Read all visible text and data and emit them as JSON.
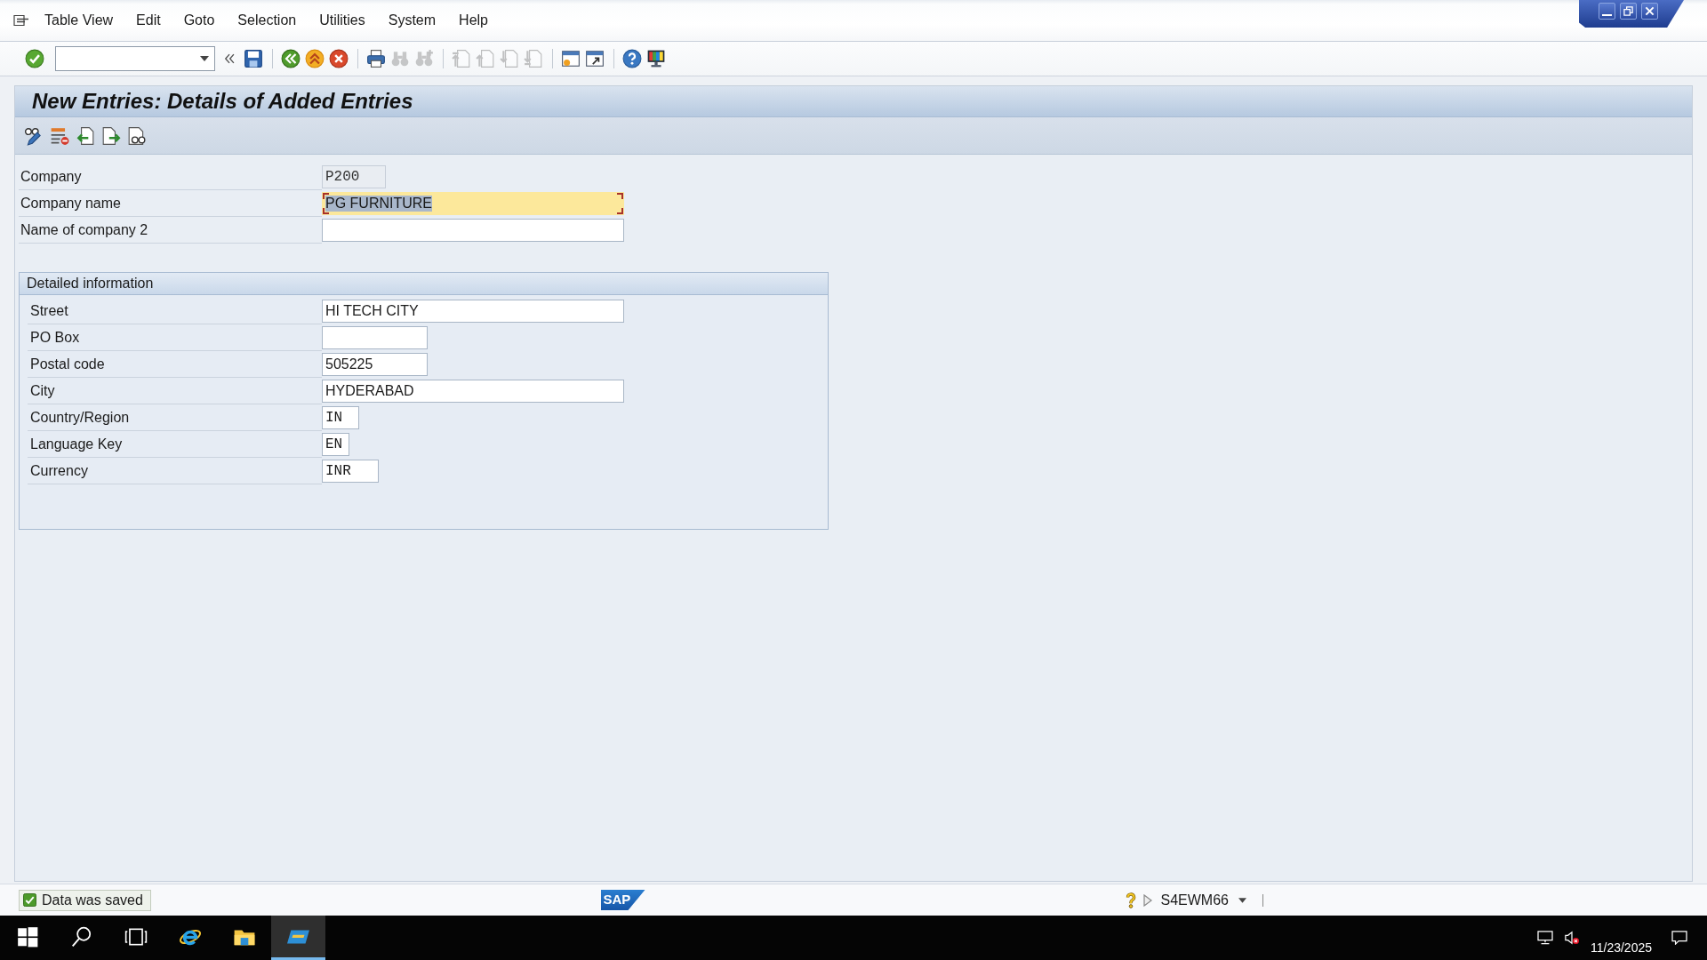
{
  "menu_bar": {
    "items": [
      "Table View",
      "Edit",
      "Goto",
      "Selection",
      "Utilities",
      "System",
      "Help"
    ]
  },
  "toolbar": {
    "groups": [
      [
        {
          "kind": "enter",
          "disabled": false
        },
        {
          "kind": "command-field",
          "disabled": false
        },
        {
          "kind": "collapse",
          "disabled": false
        },
        {
          "kind": "save",
          "disabled": false
        }
      ],
      [
        {
          "kind": "back",
          "disabled": false
        },
        {
          "kind": "exit",
          "disabled": false
        },
        {
          "kind": "cancel",
          "disabled": false
        }
      ],
      [
        {
          "kind": "print",
          "disabled": false
        },
        {
          "kind": "find",
          "disabled": true
        },
        {
          "kind": "find-next",
          "disabled": true
        }
      ],
      [
        {
          "kind": "first-page",
          "disabled": true
        },
        {
          "kind": "previous-page",
          "disabled": true
        },
        {
          "kind": "next-page",
          "disabled": true
        },
        {
          "kind": "last-page",
          "disabled": true
        }
      ],
      [
        {
          "kind": "new-session",
          "disabled": false
        },
        {
          "kind": "shortcut",
          "disabled": false
        }
      ],
      [
        {
          "kind": "help",
          "disabled": false
        },
        {
          "kind": "layout",
          "disabled": false
        }
      ]
    ]
  },
  "title": "New Entries: Details of Added Entries",
  "header_fields": [
    {
      "label": "Company",
      "value": "P200",
      "kind": "code",
      "editable": false,
      "focused": false
    },
    {
      "label": "Company name",
      "value": "PG FURNITURE",
      "kind": "text",
      "editable": true,
      "focused": true
    },
    {
      "label": "Name of company 2",
      "kind": "text",
      "editable": true,
      "focused": false
    }
  ],
  "detail_group": {
    "title": "Detailed information",
    "fields": [
      {
        "label": "Street",
        "value": "HI TECH CITY",
        "kind": "text",
        "editable": true,
        "focused": false
      },
      {
        "label": "PO Box",
        "kind": "text",
        "editable": true,
        "focused": false
      },
      {
        "label": "Postal code",
        "value": "505225",
        "kind": "text",
        "editable": true,
        "focused": false
      },
      {
        "label": "City",
        "value": "HYDERABAD",
        "kind": "text",
        "editable": true,
        "focused": false
      },
      {
        "label": "Country/Region",
        "value": "IN",
        "kind": "code",
        "editable": true,
        "focused": false
      },
      {
        "label": "Language Key",
        "value": "EN",
        "kind": "code",
        "editable": true,
        "focused": false
      },
      {
        "label": "Currency",
        "value": "INR",
        "kind": "code",
        "editable": true,
        "focused": false
      }
    ]
  },
  "status_bar": {
    "message": {
      "kind": "success",
      "text": "Data was saved"
    },
    "logo": "SAP",
    "system": "S4EWM66"
  },
  "taskbar": {
    "items": [
      {
        "kind": "start",
        "active": false
      },
      {
        "kind": "search",
        "active": false
      },
      {
        "kind": "task-view",
        "active": false
      },
      {
        "kind": "browser",
        "active": false
      },
      {
        "kind": "file-explorer",
        "active": false
      },
      {
        "kind": "sap-gui",
        "active": true
      }
    ],
    "date": "11/23/2025"
  }
}
